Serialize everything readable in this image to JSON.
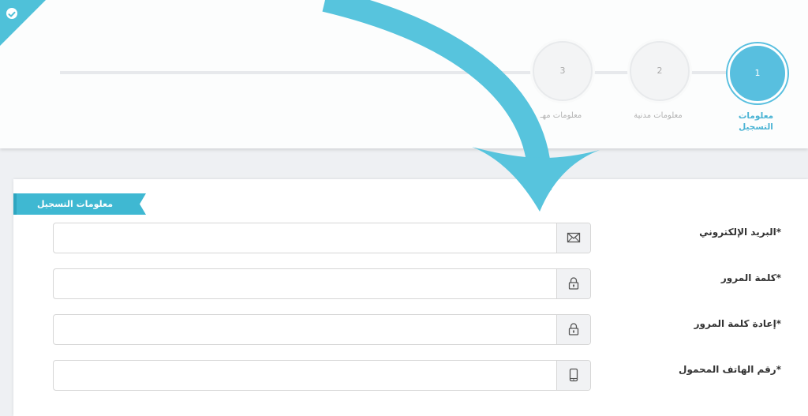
{
  "header": {
    "badge_icon": "check-circle-icon",
    "accent_color": "#58bfdf",
    "steps": [
      {
        "number": "1",
        "label": "معلومات التسجيل",
        "active": true
      },
      {
        "number": "2",
        "label": "معلومات مدنية",
        "active": false
      },
      {
        "number": "3",
        "label": "معلومات مهـ",
        "active": false
      }
    ]
  },
  "form": {
    "section_title": "معلومات التسجيل",
    "fields": [
      {
        "label": "البريد الإلكتروني*",
        "value": "",
        "placeholder": "",
        "icon": "envelope-icon"
      },
      {
        "label": "كلمة المرور*",
        "value": "",
        "placeholder": "",
        "icon": "lock-icon"
      },
      {
        "label": "إعادة كلمة المرور*",
        "value": "",
        "placeholder": "",
        "icon": "lock-icon"
      },
      {
        "label": "رقم الهاتف المحمول*",
        "value": "",
        "placeholder": "",
        "icon": "mobile-phone-icon"
      }
    ]
  }
}
